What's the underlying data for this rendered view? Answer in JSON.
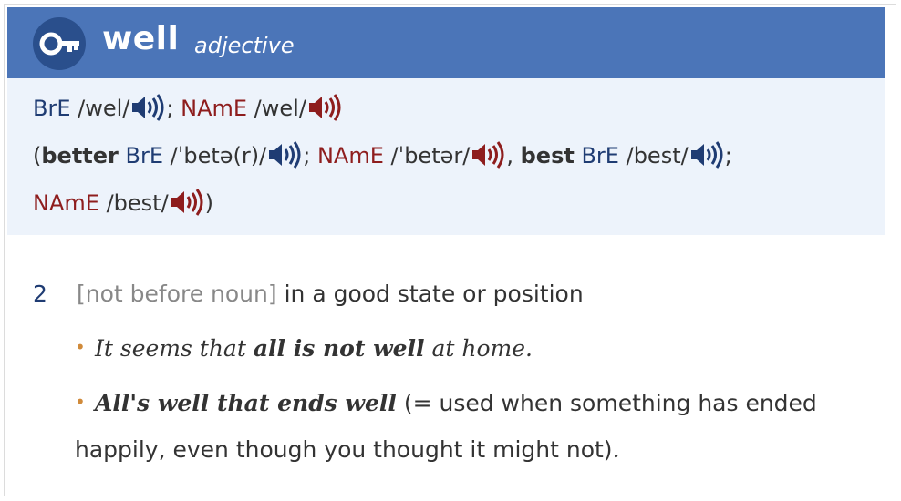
{
  "entry": {
    "headword": "well",
    "part_of_speech": "adjective",
    "icon": "key-icon"
  },
  "pronunciation": {
    "line1": {
      "bre_label": "BrE",
      "bre_ipa": "/wel/",
      "sep": ";",
      "name_label": "NAmE",
      "name_ipa": "/wel/"
    },
    "line2": {
      "open": "(",
      "better_word": "better",
      "bre_label": "BrE",
      "bre_ipa": "/ˈbetə(r)/",
      "sep1": ";",
      "name_label": "NAmE",
      "name_ipa": "/ˈbetər/",
      "sep2": ",",
      "best_word": "best",
      "bre_label2": "BrE",
      "bre_ipa2": "/best/",
      "sep3": ";"
    },
    "line3": {
      "name_label": "NAmE",
      "name_ipa": "/best/",
      "close": ")"
    },
    "colors": {
      "bre": "#1f3c73",
      "name": "#8e1d1d"
    }
  },
  "sense": {
    "number": "2",
    "grammar": "[not before noun]",
    "definition": "in a good state or position"
  },
  "examples": {
    "ex1": {
      "before": "It seems that ",
      "bold": "all is not well",
      "after": " at home."
    },
    "ex2": {
      "bold": "All's well that ends well",
      "gloss": " (= used when something has ended happily, even though you thought it might not)",
      "end": "."
    }
  },
  "colors": {
    "header": "#4b75b8",
    "badge": "#2a4f8c",
    "pron_bg": "#edf3fb",
    "bullet": "#d08a3a"
  }
}
